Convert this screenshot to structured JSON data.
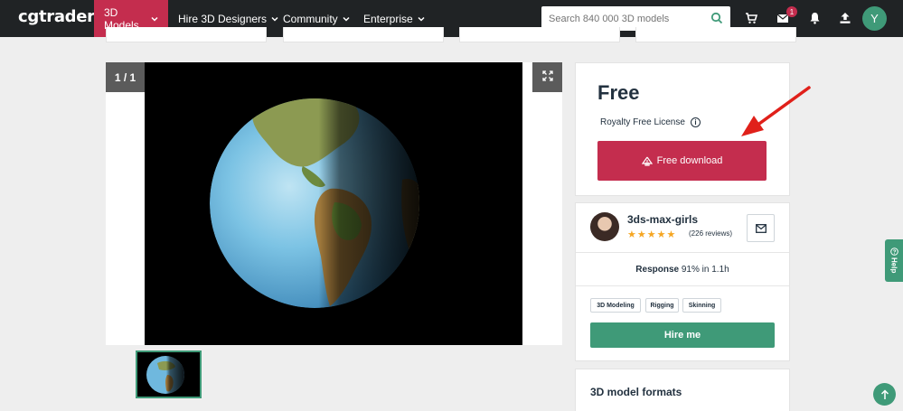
{
  "navbar": {
    "logo": "cgtrader",
    "items": [
      {
        "label": "3D Models",
        "active": true
      },
      {
        "label": "Hire 3D Designers",
        "active": false
      },
      {
        "label": "Community",
        "active": false
      },
      {
        "label": "Enterprise",
        "active": false
      }
    ],
    "search_placeholder": "Search 840 000 3D models",
    "icons": [
      "cart-icon",
      "mail-icon",
      "bell-icon",
      "upload-icon"
    ],
    "mail_badge": "1",
    "user_initial": "Y",
    "colors": {
      "bar": "#202325",
      "active": "#c42d4e",
      "avatar": "#3f9a78"
    }
  },
  "gallery": {
    "counter": "1 / 1",
    "expand_icon": "expand-icon"
  },
  "purchase": {
    "price": "Free",
    "license": "Royalty Free License",
    "download_label": "Free download",
    "button_color": "#c42d4e"
  },
  "seller": {
    "name": "3ds-max-girls",
    "rating_stars": 5,
    "reviews": "(226 reviews)",
    "response_label": "Response",
    "response_value": "91% in 1.1h",
    "skills": [
      "3D Modeling",
      "Rigging",
      "Skinning"
    ],
    "hire_label": "Hire me",
    "hire_color": "#3f9a78"
  },
  "formats": {
    "title": "3D model formats"
  },
  "help": {
    "label": "Help"
  }
}
